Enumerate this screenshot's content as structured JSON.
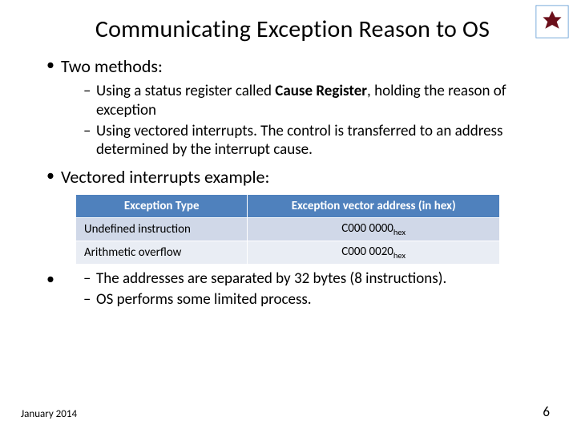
{
  "title": "Communicating Exception Reason to OS",
  "bullets": {
    "b1": "Two methods:",
    "b1_sub1_pre": "Using a status register called ",
    "b1_sub1_bold": "Cause Register",
    "b1_sub1_post": ", holding the reason of exception",
    "b1_sub2": "Using vectored interrupts. The control is transferred to an address determined by the interrupt cause.",
    "b2": "Vectored interrupts example:",
    "b2_sub1": "The addresses are separated by 32 bytes (8 instructions).",
    "b2_sub2": "OS performs some limited process."
  },
  "table": {
    "headers": {
      "col1": "Exception Type",
      "col2": "Exception vector address (in hex)"
    },
    "rows": [
      {
        "type": "Undefined instruction",
        "addr_main": "C000 0000",
        "addr_sub": "hex"
      },
      {
        "type": "Arithmetic overflow",
        "addr_main": "C000 0020",
        "addr_sub": "hex"
      }
    ]
  },
  "footer": {
    "date": "January 2014",
    "page": "6"
  },
  "logo": {
    "name": "technion-logo"
  }
}
